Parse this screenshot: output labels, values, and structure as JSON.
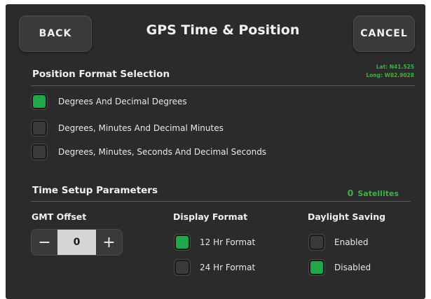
{
  "header": {
    "back_label": "BACK",
    "title": "GPS Time & Position",
    "cancel_label": "CANCEL"
  },
  "coords": {
    "lat": "Lat: N41.525",
    "long": "Long: W82.9028"
  },
  "position_format": {
    "title": "Position Format Selection",
    "options": [
      {
        "label": "Degrees And Decimal Degrees",
        "checked": true
      },
      {
        "label": "Degrees, Minutes And Decimal Minutes",
        "checked": false
      },
      {
        "label": "Degrees, Minutes, Seconds And Decimal Seconds",
        "checked": false
      }
    ]
  },
  "time_setup": {
    "title": "Time Setup Parameters",
    "satellites_count": "0",
    "satellites_label": "Satellites",
    "gmt_offset": {
      "title": "GMT Offset",
      "minus": "−",
      "value": "0",
      "plus": "+"
    },
    "display_format": {
      "title": "Display Format",
      "options": [
        {
          "label": "12 Hr Format",
          "checked": true
        },
        {
          "label": "24 Hr Format",
          "checked": false
        }
      ]
    },
    "daylight_saving": {
      "title": "Daylight Saving",
      "options": [
        {
          "label": "Enabled",
          "checked": false
        },
        {
          "label": "Disabled",
          "checked": true
        }
      ]
    }
  },
  "colors": {
    "background": "#2b2b2b",
    "accent_green": "#22a84a",
    "text_green": "#3fae4a"
  }
}
